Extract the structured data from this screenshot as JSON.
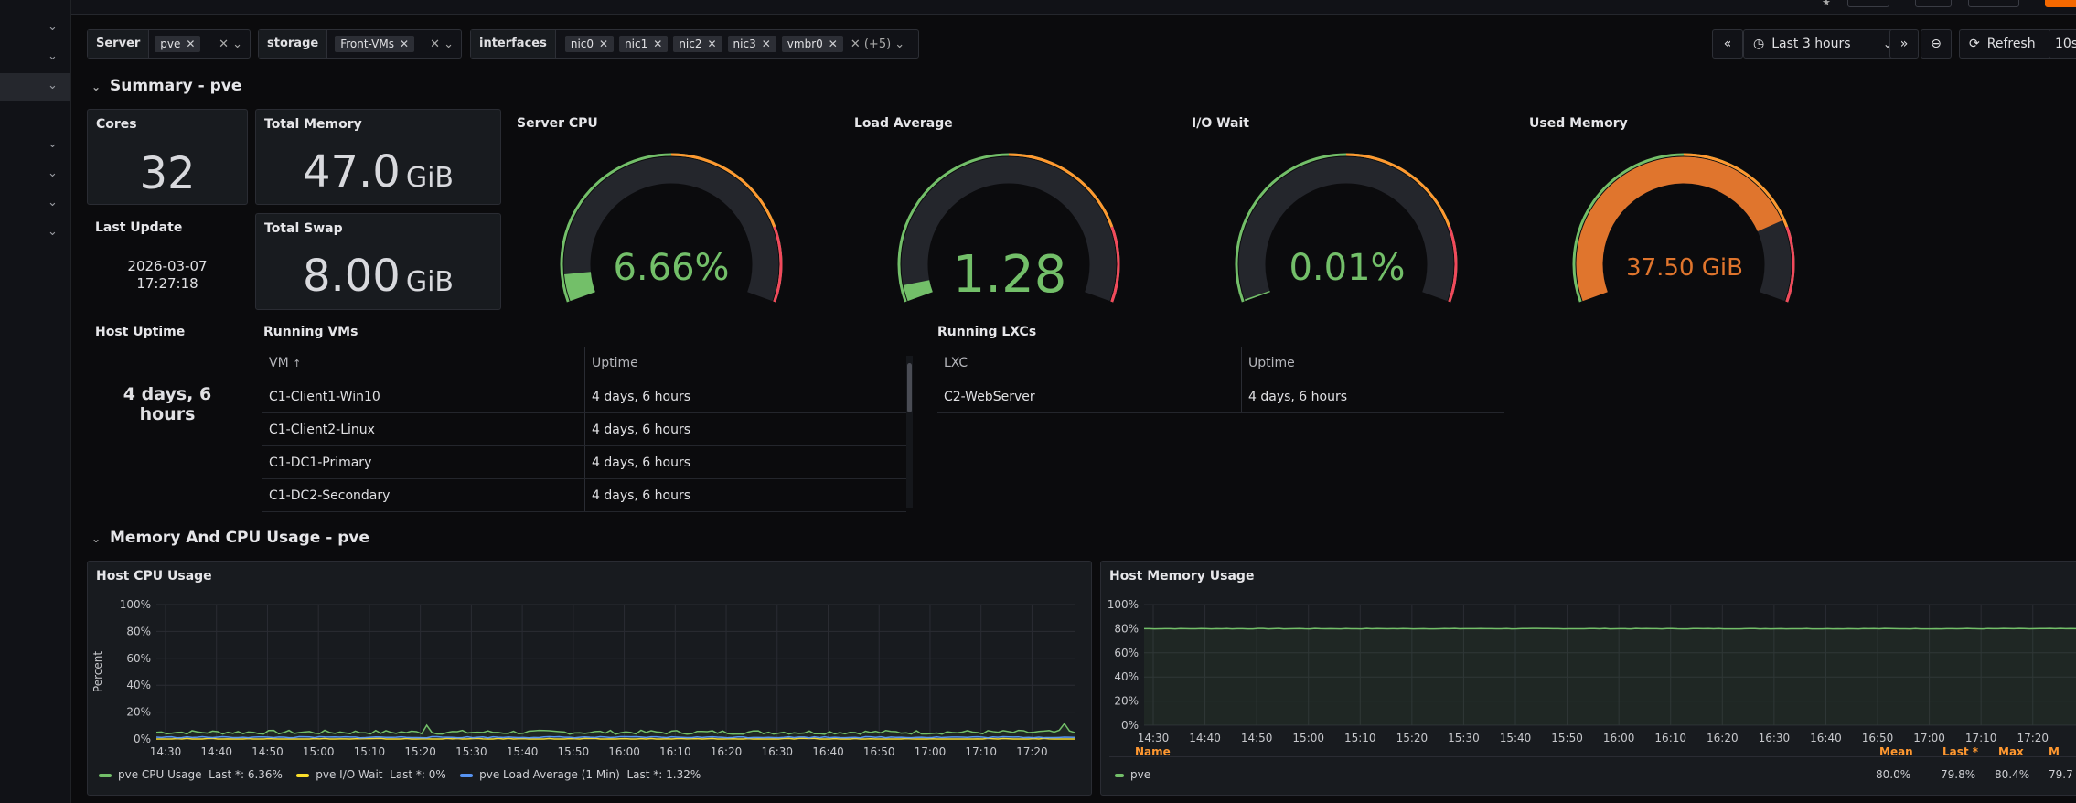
{
  "colors": {
    "green": "#73bf69",
    "orange": "#ff9830",
    "red": "#f2495c",
    "yellow": "#fade2a",
    "blue": "#5794f2",
    "accent": "#f46800"
  },
  "variables": [
    {
      "label": "Server",
      "chips": [
        "pve"
      ]
    },
    {
      "label": "storage",
      "chips": [
        "Front-VMs"
      ]
    },
    {
      "label": "interfaces",
      "chips": [
        "nic0",
        "nic1",
        "nic2",
        "nic3",
        "vmbr0"
      ],
      "more": "(+5)"
    }
  ],
  "toolbar": {
    "time_range": "Last 3 hours",
    "refresh": "Refresh",
    "refresh_interval": "10s"
  },
  "rows": {
    "summary": "Summary - pve",
    "usage": "Memory And CPU Usage - pve"
  },
  "stats": {
    "cores": {
      "title": "Cores",
      "value": "32"
    },
    "total_memory": {
      "title": "Total Memory",
      "value": "47.0",
      "unit": "GiB"
    },
    "total_swap": {
      "title": "Total Swap",
      "value": "8.00",
      "unit": "GiB"
    },
    "last_update": {
      "title": "Last Update",
      "date": "2026-03-07",
      "time": "17:27:18"
    },
    "host_uptime": {
      "title": "Host Uptime",
      "value": "4 days, 6 hours"
    }
  },
  "gauges": [
    {
      "title": "Server CPU",
      "value": "6.66%",
      "fraction": 0.0666,
      "color": "#73bf69"
    },
    {
      "title": "Load Average",
      "value": "1.28",
      "fraction": 0.04,
      "color": "#73bf69"
    },
    {
      "title": "I/O Wait",
      "value": "0.01%",
      "fraction": 0.0001,
      "color": "#73bf69"
    },
    {
      "title": "Used Memory",
      "value": "37.50 GiB",
      "fraction": 0.8,
      "color": "#e0752d"
    }
  ],
  "running_vms": {
    "title": "Running VMs",
    "columns": [
      "VM",
      "Uptime"
    ],
    "rows": [
      [
        "C1-Client1-Win10",
        "4 days, 6 hours"
      ],
      [
        "C1-Client2-Linux",
        "4 days, 6 hours"
      ],
      [
        "C1-DC1-Primary",
        "4 days, 6 hours"
      ],
      [
        "C1-DC2-Secondary",
        "4 days, 6 hours"
      ]
    ]
  },
  "running_lxcs": {
    "title": "Running LXCs",
    "columns": [
      "LXC",
      "Uptime"
    ],
    "rows": [
      [
        "C2-WebServer",
        "4 days, 6 hours"
      ]
    ]
  },
  "cpu_chart": {
    "title": "Host CPU Usage",
    "chart_data": {
      "type": "line",
      "ylabel": "Percent",
      "ylim": [
        0,
        100
      ],
      "yticks": [
        "0%",
        "20%",
        "40%",
        "60%",
        "80%",
        "100%"
      ],
      "x": [
        "14:30",
        "14:40",
        "14:50",
        "15:00",
        "15:10",
        "15:20",
        "15:30",
        "15:40",
        "15:50",
        "16:00",
        "16:10",
        "16:20",
        "16:30",
        "16:40",
        "16:50",
        "17:00",
        "17:10",
        "17:20"
      ],
      "series": [
        {
          "name": "pve CPU Usage",
          "color": "#73bf69",
          "approx": 5
        },
        {
          "name": "pve I/O Wait",
          "color": "#fade2a",
          "approx": 0
        },
        {
          "name": "pve Load Average (1 Min)",
          "color": "#5794f2",
          "approx": 1.3
        }
      ]
    },
    "legend": [
      {
        "name": "pve CPU Usage",
        "last": "Last *: 6.36%"
      },
      {
        "name": "pve I/O Wait",
        "last": "Last *: 0%"
      },
      {
        "name": "pve Load Average (1 Min)",
        "last": "Last *: 1.32%"
      }
    ]
  },
  "mem_chart": {
    "title": "Host Memory Usage",
    "chart_data": {
      "type": "area",
      "ylim": [
        0,
        100
      ],
      "yticks": [
        "0%",
        "20%",
        "40%",
        "60%",
        "80%",
        "100%"
      ],
      "x": [
        "14:30",
        "14:40",
        "14:50",
        "15:00",
        "15:10",
        "15:20",
        "15:30",
        "15:40",
        "15:50",
        "16:00",
        "16:10",
        "16:20",
        "16:30",
        "16:40",
        "16:50",
        "17:00",
        "17:10",
        "17:20"
      ],
      "series": [
        {
          "name": "pve",
          "color": "#73bf69",
          "approx": 80
        }
      ]
    },
    "legend_headers": [
      "Name",
      "Mean",
      "Last *",
      "Max"
    ],
    "legend_rows": [
      {
        "name": "pve",
        "mean": "80.0%",
        "last": "79.8%",
        "max": "80.4%",
        "extra": "79.7"
      }
    ]
  }
}
